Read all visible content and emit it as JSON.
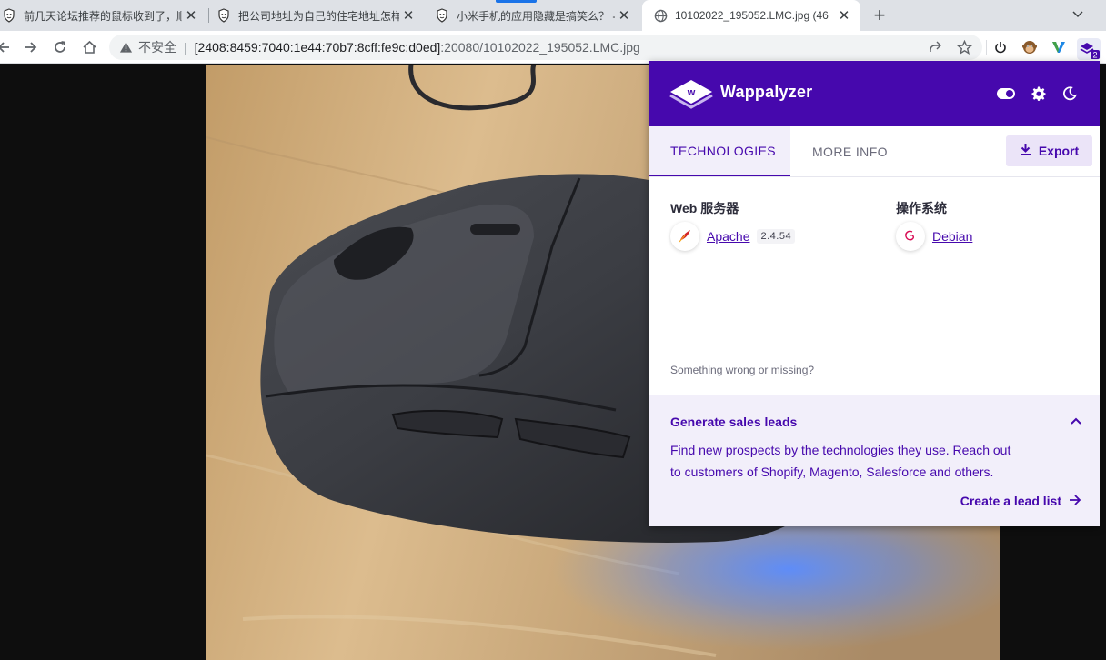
{
  "browser": {
    "tabs": [
      {
        "title": "前几天论坛推荐的鼠标收到了，顺",
        "favicon": "forum-favicon",
        "active": false
      },
      {
        "title": "把公司地址为自己的住宅地址怎样",
        "favicon": "forum-favicon",
        "active": false
      },
      {
        "title": "小米手机的应用隐藏是搞笑么？ -",
        "favicon": "forum-favicon",
        "active": false
      },
      {
        "title": "10102022_195052.LMC.jpg (46",
        "favicon": "globe-favicon",
        "active": true
      }
    ],
    "address": {
      "security_label": "不安全",
      "separator": "|",
      "host": "[2408:8459:7040:1e44:70b7:8cff:fe9c:d0ed]",
      "path": ":20080/10102022_195052.LMC.jpg"
    },
    "extension_badge": "2"
  },
  "wappalyzer": {
    "brand": "Wappalyzer",
    "tabs": {
      "technologies": "TECHNOLOGIES",
      "more_info": "MORE INFO"
    },
    "export_label": "Export",
    "categories": [
      {
        "title": "Web 服务器",
        "tech": {
          "name": "Apache",
          "version": "2.4.54",
          "icon": "apache-feather-icon"
        }
      },
      {
        "title": "操作系统",
        "tech": {
          "name": "Debian",
          "version": "",
          "icon": "debian-swirl-icon"
        }
      }
    ],
    "report_link": "Something wrong or missing?",
    "leads": {
      "title": "Generate sales leads",
      "text_line1": "Find new prospects by the technologies they use. Reach out",
      "text_line2": "to customers of Shopify, Magento, Salesforce and others.",
      "cta": "Create a lead list"
    },
    "colors": {
      "brand": "#4608ad",
      "panel_bg": "#f2effa"
    }
  }
}
